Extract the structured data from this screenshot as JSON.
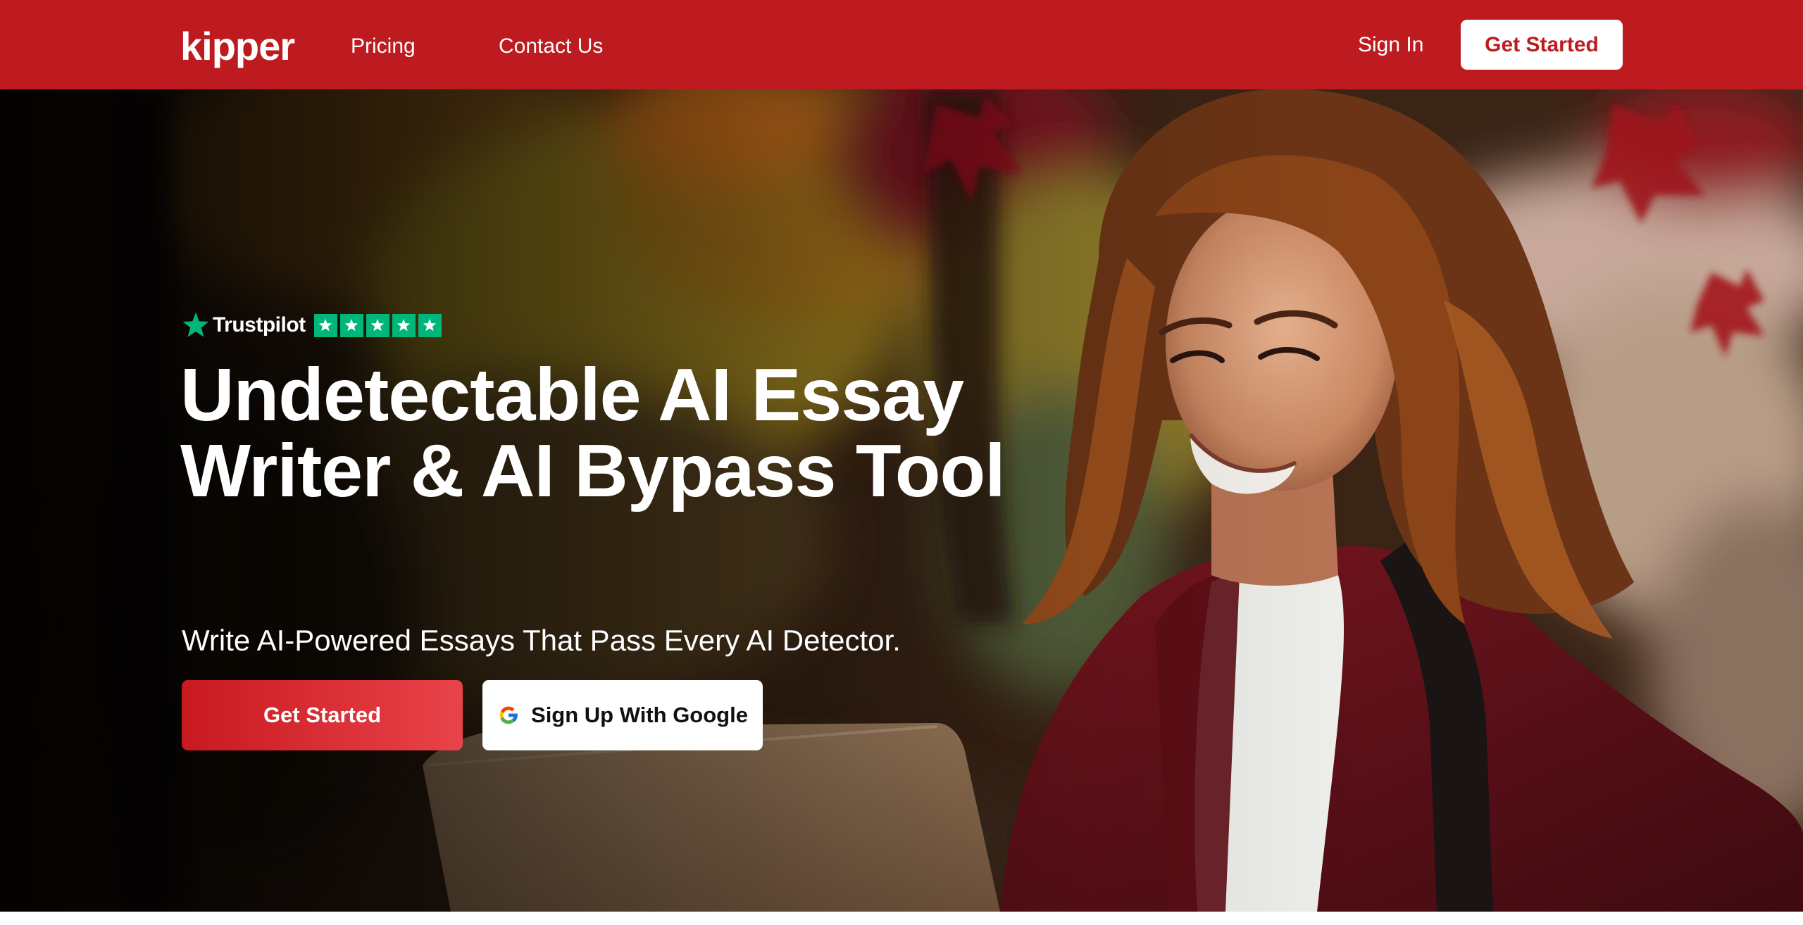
{
  "nav": {
    "logo": "kipper",
    "links": [
      {
        "label": "Pricing"
      },
      {
        "label": "Contact Us"
      }
    ],
    "sign_in": "Sign In",
    "cta": "Get Started"
  },
  "hero": {
    "trustpilot": {
      "brand": "Trustpilot",
      "rating_stars": 5,
      "star_color": "#00b67a"
    },
    "headline_line1": "Undetectable AI Essay",
    "headline_line2": "Writer & AI Bypass Tool",
    "subheadline": "Write AI-Powered Essays That Pass Every AI Detector.",
    "primary_cta": "Get Started",
    "google_cta": "Sign Up With Google",
    "google_icon": "google-g-icon",
    "background_image": "smiling-student-with-laptop-photo"
  },
  "colors": {
    "brand_red": "#bd1b1f",
    "cta_gradient_start": "#c8191f",
    "cta_gradient_end": "#e9434a",
    "text_on_dark": "#ffffff"
  }
}
